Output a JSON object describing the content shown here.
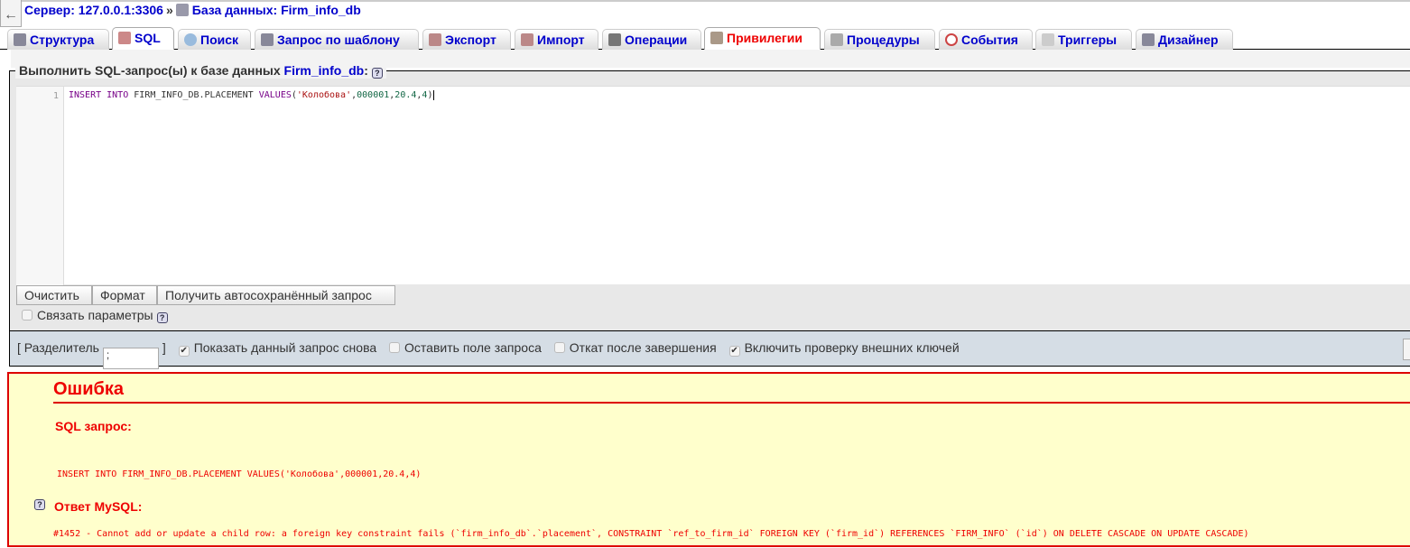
{
  "breadcrumb": {
    "server": "Сервер: 127.0.0.1:3306",
    "separator": "»",
    "database": "База данных: Firm_info_db"
  },
  "tabs": [
    {
      "label": "Структура",
      "icon": "structure-icon"
    },
    {
      "label": "SQL",
      "icon": "sql-icon",
      "active": true
    },
    {
      "label": "Поиск",
      "icon": "search-icon"
    },
    {
      "label": "Запрос по шаблону",
      "icon": "query-icon"
    },
    {
      "label": "Экспорт",
      "icon": "export-icon"
    },
    {
      "label": "Импорт",
      "icon": "import-icon"
    },
    {
      "label": "Операции",
      "icon": "tools-icon"
    },
    {
      "label": "Привилегии",
      "icon": "users-icon",
      "highlighted": true
    },
    {
      "label": "Процедуры",
      "icon": "routines-icon"
    },
    {
      "label": "События",
      "icon": "clock-icon"
    },
    {
      "label": "Триггеры",
      "icon": "triggers-icon"
    },
    {
      "label": "Дизайнер",
      "icon": "designer-icon"
    }
  ],
  "query_panel": {
    "legend": "Выполнить SQL-запрос(ы) к базе данных",
    "db": "Firm_info_db",
    "colon": ":",
    "line_number": "1",
    "code": {
      "kw1": "INSERT INTO",
      "table": " FIRM_INFO_DB.PLACEMENT ",
      "kw2": "VALUES",
      "p1": "(",
      "str": "'Колобова'",
      "c1": ",",
      "n1": "000001",
      "c2": ",",
      "n2": "20.4",
      "c3": ",",
      "n3": "4",
      "p2": ")"
    },
    "buttons": {
      "clear": "Очистить",
      "format": "Формат",
      "autosaved": "Получить автосохранённый запрос"
    },
    "bind_params": "Связать параметры"
  },
  "options": {
    "delimiter_label": "[ Разделитель",
    "delimiter_value": ";",
    "bracket": "]",
    "show_query": {
      "label": "Показать данный запрос снова",
      "checked": true
    },
    "retain_box": {
      "label": "Оставить поле запроса",
      "checked": false
    },
    "rollback": {
      "label": "Откат после завершения",
      "checked": false
    },
    "fk_checks": {
      "label": "Включить проверку внешних ключей",
      "checked": true
    }
  },
  "error": {
    "title": "Ошибка",
    "sql_heading": "SQL запрос:",
    "sql": "INSERT INTO FIRM_INFO_DB.PLACEMENT VALUES('Колобова',000001,20.4,4)",
    "response_heading": "Ответ MySQL:",
    "response": "#1452 - Cannot add or update a child row: a foreign key constraint fails (`firm_info_db`.`placement`, CONSTRAINT `ref_to_firm_id` FOREIGN KEY (`firm_id`) REFERENCES `FIRM_INFO` (`id`) ON DELETE CASCADE ON UPDATE CASCADE)"
  },
  "colors": {
    "link": "#0000cc",
    "error": "#ee0000",
    "error_bg": "#ffffcc",
    "options_bg": "#d5dde5"
  }
}
